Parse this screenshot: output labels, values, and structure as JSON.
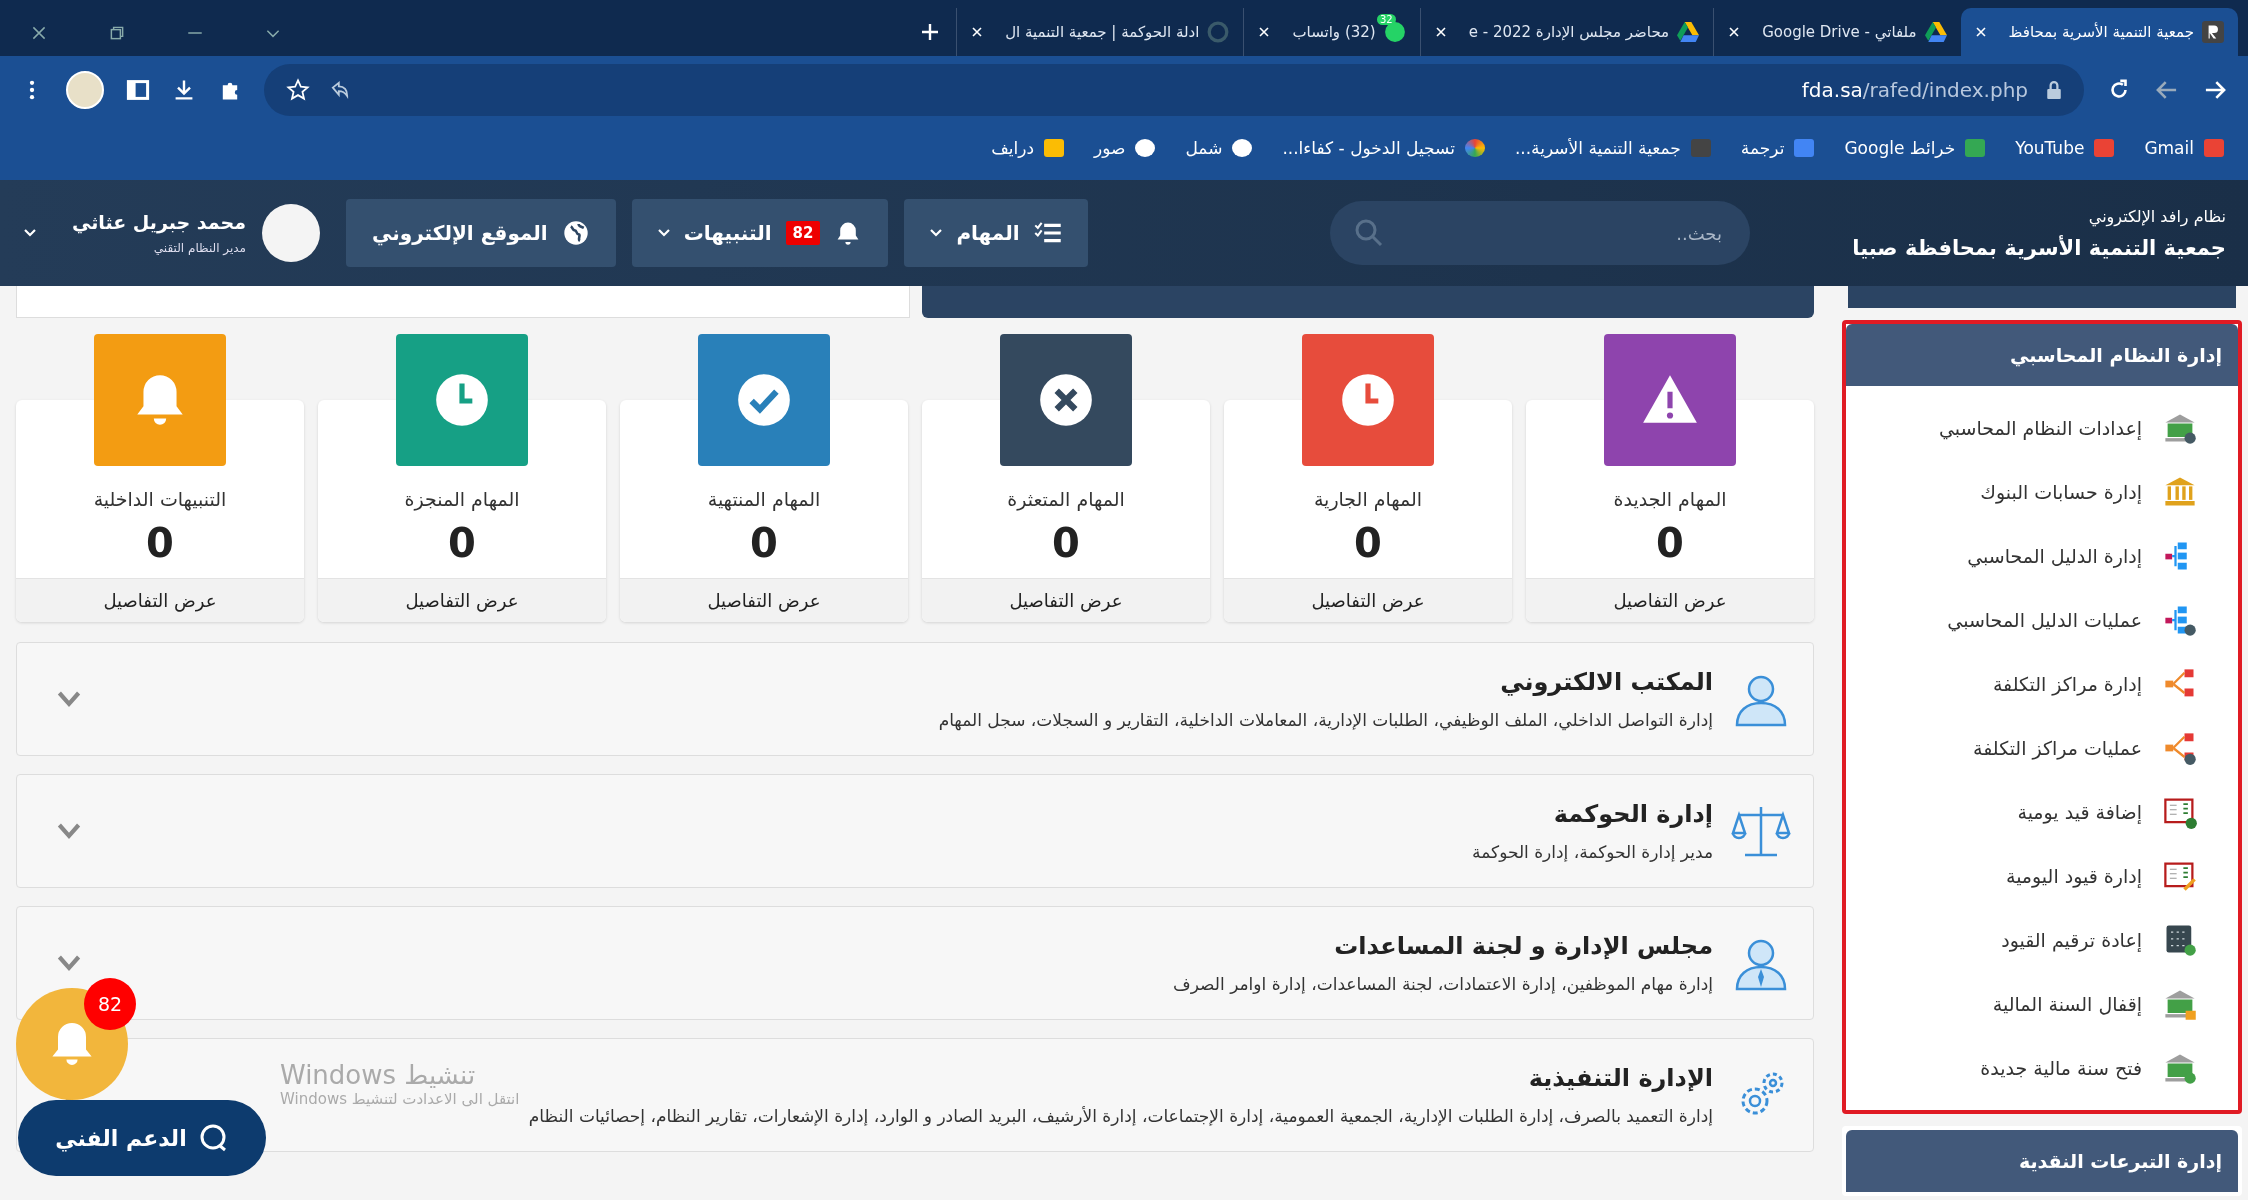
{
  "tabs": [
    {
      "title": "جمعية التنمية الأسرية بمحافظ",
      "selected": true
    },
    {
      "title": "ملفاتي - Google Drive",
      "selected": false
    },
    {
      "title": "محاضر مجلس الإدارة 2022 - e",
      "selected": false
    },
    {
      "title": "(32) واتساب",
      "selected": false,
      "badge": "32"
    },
    {
      "title": "ادلة الحوكمة | جمعية التنمية ال",
      "selected": false
    }
  ],
  "address": {
    "url_host": "fda.sa",
    "url_path": "/rafed/index.php"
  },
  "bookmarks": [
    {
      "label": "Gmail"
    },
    {
      "label": "YouTube"
    },
    {
      "label": "خرائط Google"
    },
    {
      "label": "ترجمة"
    },
    {
      "label": "جمعية التنمية الأسرية..."
    },
    {
      "label": "تسجيل الدخول - كفاءا..."
    },
    {
      "label": "شمل"
    },
    {
      "label": "صور"
    },
    {
      "label": "درايف"
    }
  ],
  "header": {
    "system_name": "نظام رافد الإلكتروني",
    "org_name": "جمعية التنمية الأسرية بمحافظة صبيا",
    "search": {
      "placeholder": "بحث.."
    },
    "tasks_button": "المهام",
    "alerts_button": {
      "label": "التنبيهات",
      "count": "82"
    },
    "website_button": "الموقع الإلكتروني",
    "user": {
      "name": "محمد جبريل عثاثي",
      "role": "مدير النظام التقني"
    }
  },
  "stats": [
    {
      "title": "المهام الجديدة",
      "value": "0",
      "link": "عرض التفاصيل",
      "color": "#8e44ad"
    },
    {
      "title": "المهام الجارية",
      "value": "0",
      "link": "عرض التفاصيل",
      "color": "#e74c3c"
    },
    {
      "title": "المهام المتعثرة",
      "value": "0",
      "link": "عرض التفاصيل",
      "color": "#34495e"
    },
    {
      "title": "المهام المنتهية",
      "value": "0",
      "link": "عرض التفاصيل",
      "color": "#2980b9"
    },
    {
      "title": "المهام المنجزة",
      "value": "0",
      "link": "عرض التفاصيل",
      "color": "#16a085"
    },
    {
      "title": "التنبيهات الداخلية",
      "value": "0",
      "link": "عرض التفاصيل",
      "color": "#f39c12"
    }
  ],
  "modules": [
    {
      "title": "المكتب الالكتروني",
      "description": "إدارة التواصل الداخلي، الملف الوظيفي، الطلبات الإدارية، المعاملات الداخلية، التقارير و السجلات، سجل المهام"
    },
    {
      "title": "إدارة الحوكمة",
      "description": "مدير إدارة الحوكمة، إدارة الحوكمة"
    },
    {
      "title": "مجلس الإدارة و لجنة المساعدات",
      "description": "إدارة مهام الموظفين، إدارة الاعتمادات، لجنة المساعدات، إدارة اوامر الصرف"
    },
    {
      "title": "الإدارة التنفيذية",
      "description": "إدارة التعميد بالصرف، إدارة الطلبات الإدارية، الجمعية العمومية، إدارة الإجتماعات، إدارة الأرشيف، البريد الصادر و الوارد، إدارة الإشعارات، تقارير النظام، إحصائيات النظام"
    }
  ],
  "sidebar": {
    "sections": [
      {
        "title": "إدارة النظام المحاسبي",
        "highlighted": true,
        "items": [
          {
            "label": "إعدادات النظام المحاسبي"
          },
          {
            "label": "إدارة حسابات البنوك"
          },
          {
            "label": "إدارة الدليل المحاسبي"
          },
          {
            "label": "عمليات الدليل المحاسبي"
          },
          {
            "label": "إدارة مراكز التكلفة"
          },
          {
            "label": "عمليات مراكز التكلفة"
          },
          {
            "label": "إضافة قيد يومية"
          },
          {
            "label": "إدارة قيود اليومية"
          },
          {
            "label": "إعادة ترقيم القيود"
          },
          {
            "label": "إقفال السنة المالية"
          },
          {
            "label": "فتح سنة مالية جديدة"
          }
        ]
      },
      {
        "title": "إدارة التبرعات النقدية",
        "highlighted": false
      }
    ]
  },
  "floating": {
    "alerts_count": "82",
    "support_label": "الدعم الفني"
  },
  "os_overlay": {
    "title": "تنشيط Windows",
    "subtitle": "انتقل الى الاعدادت لتنشيط Windows"
  }
}
